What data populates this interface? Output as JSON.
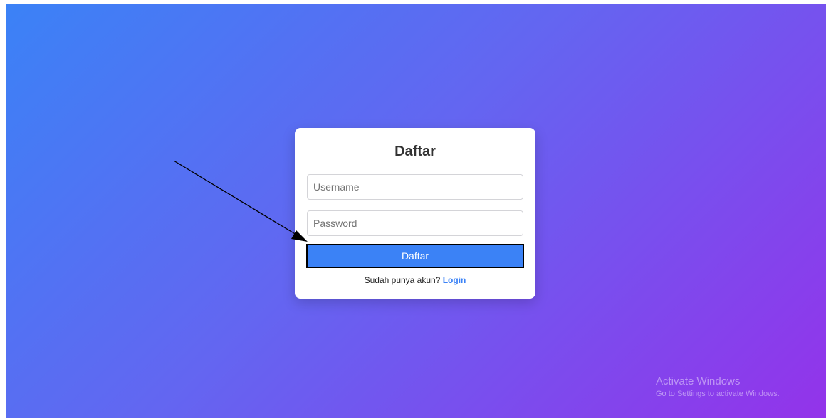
{
  "form": {
    "title": "Daftar",
    "username_placeholder": "Username",
    "password_placeholder": "Password",
    "submit_label": "Daftar",
    "login_prompt": "Sudah punya akun?",
    "login_link": "Login"
  },
  "watermark": {
    "title": "Activate Windows",
    "subtitle": "Go to Settings to activate Windows."
  },
  "colors": {
    "gradient_start": "#3b82f6",
    "gradient_end": "#9333ea",
    "button": "#3b82f6",
    "link": "#3b82f6"
  },
  "annotation": {
    "arrow_icon": "annotation-arrow-icon"
  }
}
